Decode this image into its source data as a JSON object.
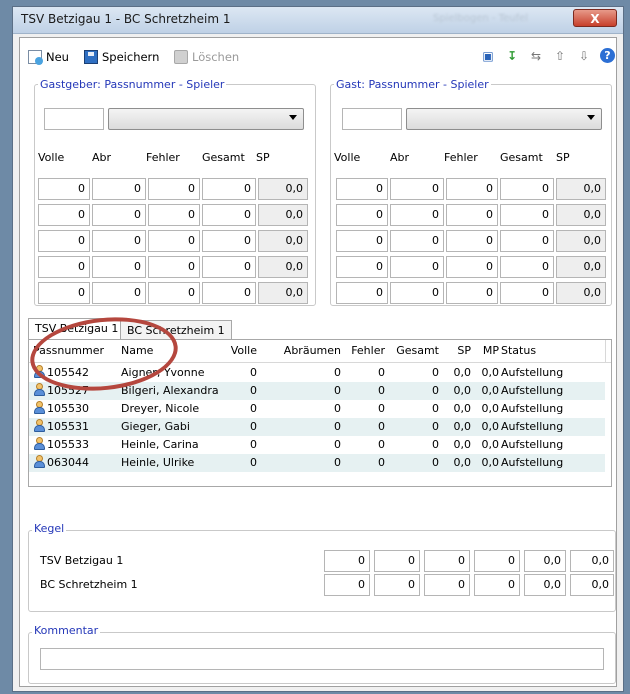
{
  "window": {
    "title": "TSV Betzigau 1 - BC Schretzheim 1",
    "blurred_text": "Spielbogen - Teufel",
    "close_label": "X"
  },
  "toolbar": {
    "new_label": "Neu",
    "save_label": "Speichern",
    "delete_label": "Löschen"
  },
  "home": {
    "group_label": "Gastgeber: Passnummer - Spieler",
    "passnumber": "",
    "headers": {
      "volle": "Volle",
      "abr": "Abr",
      "fehler": "Fehler",
      "gesamt": "Gesamt",
      "sp": "SP"
    },
    "rows": [
      [
        "0",
        "0",
        "0",
        "0",
        "0,0"
      ],
      [
        "0",
        "0",
        "0",
        "0",
        "0,0"
      ],
      [
        "0",
        "0",
        "0",
        "0",
        "0,0"
      ],
      [
        "0",
        "0",
        "0",
        "0",
        "0,0"
      ],
      [
        "0",
        "0",
        "0",
        "0",
        "0,0"
      ]
    ]
  },
  "guest": {
    "group_label": "Gast: Passnummer - Spieler",
    "passnumber": "",
    "headers": {
      "volle": "Volle",
      "abr": "Abr",
      "fehler": "Fehler",
      "gesamt": "Gesamt",
      "sp": "SP"
    },
    "rows": [
      [
        "0",
        "0",
        "0",
        "0",
        "0,0"
      ],
      [
        "0",
        "0",
        "0",
        "0",
        "0,0"
      ],
      [
        "0",
        "0",
        "0",
        "0",
        "0,0"
      ],
      [
        "0",
        "0",
        "0",
        "0",
        "0,0"
      ],
      [
        "0",
        "0",
        "0",
        "0",
        "0,0"
      ]
    ]
  },
  "tabs": [
    {
      "label": "TSV Betzigau 1",
      "active": true
    },
    {
      "label": "BC Schretzheim 1",
      "active": false
    }
  ],
  "players_table": {
    "columns": [
      "Passnummer",
      "Name",
      "Volle",
      "Abräumen",
      "Fehler",
      "Gesamt",
      "SP",
      "MP",
      "Status"
    ],
    "rows": [
      [
        "105542",
        "Aigner, Yvonne",
        "0",
        "0",
        "0",
        "0",
        "0,0",
        "0,0",
        "Aufstellung"
      ],
      [
        "105527",
        "Bilgeri, Alexandra",
        "0",
        "0",
        "0",
        "0",
        "0,0",
        "0,0",
        "Aufstellung"
      ],
      [
        "105530",
        "Dreyer, Nicole",
        "0",
        "0",
        "0",
        "0",
        "0,0",
        "0,0",
        "Aufstellung"
      ],
      [
        "105531",
        "Gieger, Gabi",
        "0",
        "0",
        "0",
        "0",
        "0,0",
        "0,0",
        "Aufstellung"
      ],
      [
        "105533",
        "Heinle, Carina",
        "0",
        "0",
        "0",
        "0",
        "0,0",
        "0,0",
        "Aufstellung"
      ],
      [
        "063044",
        "Heinle, Ulrike",
        "0",
        "0",
        "0",
        "0",
        "0,0",
        "0,0",
        "Aufstellung"
      ]
    ]
  },
  "kegel": {
    "group_label": "Kegel",
    "teams": [
      {
        "name": "TSV Betzigau 1",
        "values": [
          "0",
          "0",
          "0",
          "0",
          "0,0",
          "0,0"
        ]
      },
      {
        "name": "BC Schretzheim 1",
        "values": [
          "0",
          "0",
          "0",
          "0",
          "0,0",
          "0,0"
        ]
      }
    ]
  },
  "kommentar": {
    "group_label": "Kommentar",
    "value": ""
  },
  "colors": {
    "group_label": "#2437b8",
    "row_alt": "#e6f1f2",
    "annotation": "#b5473e",
    "window_bg": "#f0f0f0"
  }
}
